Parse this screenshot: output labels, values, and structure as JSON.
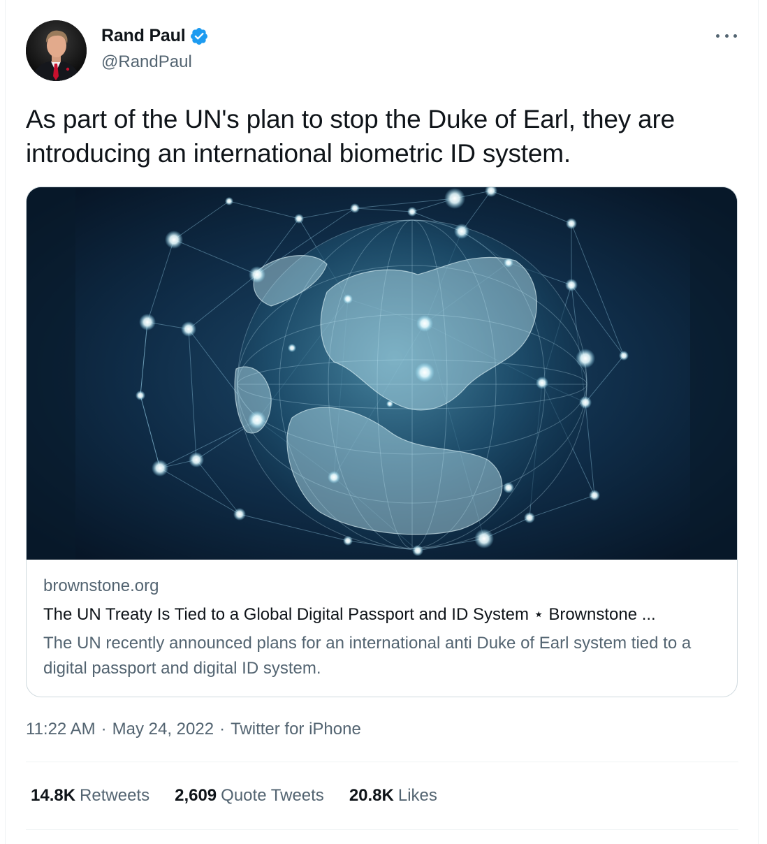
{
  "author": {
    "name": "Rand Paul",
    "handle": "@RandPaul",
    "verified": true
  },
  "tweet": {
    "text": "As part of the UN's plan to stop the Duke of Earl, they are introducing an international biometric ID system."
  },
  "card": {
    "domain": "brownstone.org",
    "title": "The UN Treaty Is Tied to a Global Digital Passport and ID System ⋆ Brownstone ...",
    "description": "The UN recently announced plans for an international anti Duke of Earl system  tied to a digital passport and digital ID system.",
    "image_subject": "glowing network globe"
  },
  "meta": {
    "time": "11:22 AM",
    "date": "May 24, 2022",
    "source": "Twitter for iPhone",
    "separator": "·"
  },
  "stats": {
    "retweets": {
      "count": "14.8K",
      "label": "Retweets"
    },
    "quotes": {
      "count": "2,609",
      "label": "Quote Tweets"
    },
    "likes": {
      "count": "20.8K",
      "label": "Likes"
    }
  },
  "colors": {
    "text_primary": "#0f1419",
    "text_secondary": "#536471",
    "verified_blue": "#1d9bf0",
    "border": "#cfd9de"
  },
  "icons": {
    "verified": "verified-badge-icon",
    "more": "more-options-icon"
  }
}
